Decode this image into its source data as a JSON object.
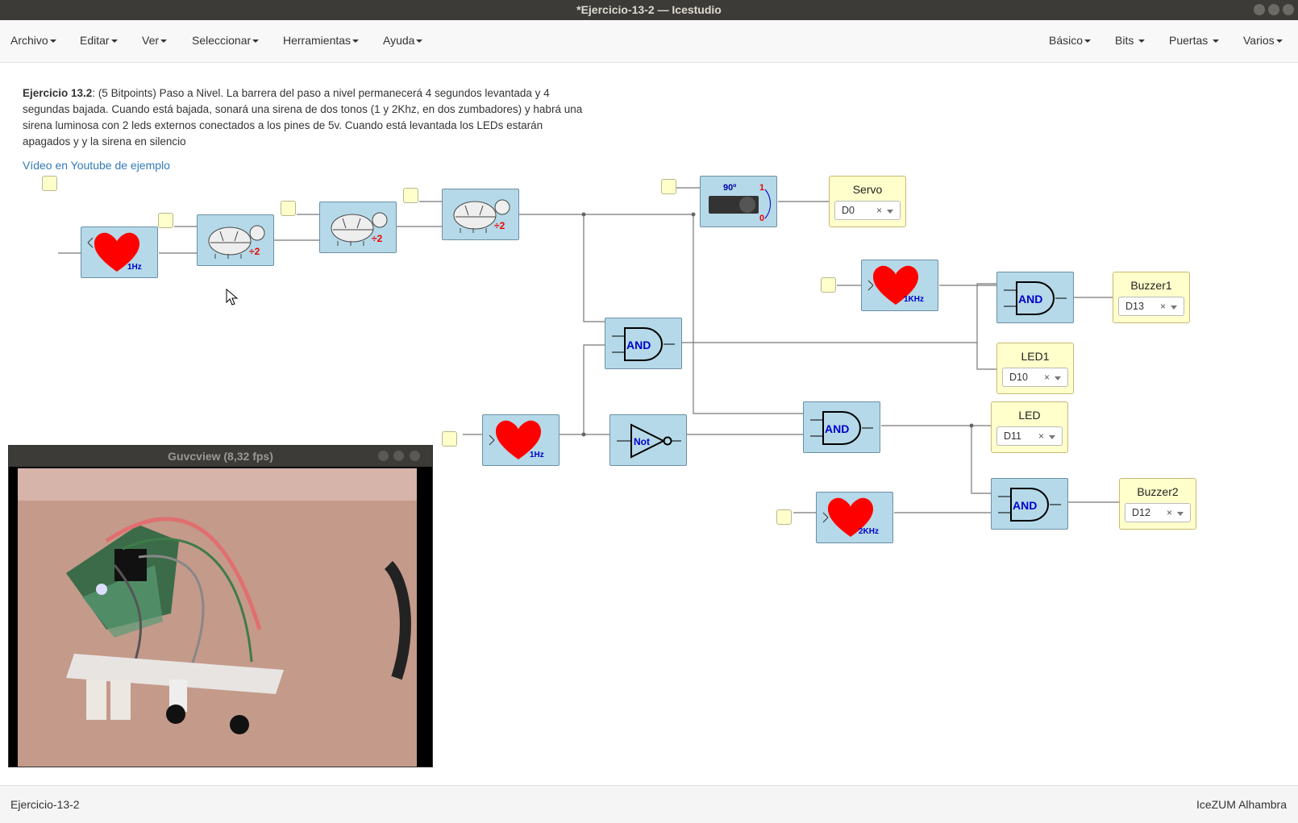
{
  "window": {
    "title": "*Ejercicio-13-2 — Icestudio"
  },
  "menu": {
    "left": [
      "Archivo",
      "Editar",
      "Ver",
      "Seleccionar",
      "Herramientas",
      "Ayuda"
    ],
    "right": [
      "Básico",
      "Bits",
      "Puertas",
      "Varios"
    ]
  },
  "description": {
    "title": "Ejercicio 13.2",
    "text": ": (5 Bitpoints) Paso a Nivel. La barrera del paso a nivel permanecerá 4 segundos levantada y 4 segundas bajada. Cuando está bajada, sonará una sirena de dos tonos (1 y 2Khz, en dos zumbadores) y habrá una sirena luminosa con 2 leds externos conectados a los pines de 5v. Cuando está levantada los LEDs estarán apagados y y la sirena en silencio",
    "link": "Vídeo en Youtube de ejemplo"
  },
  "blocks": {
    "heart1": "1Hz",
    "heart2": "1Hz",
    "heart3": "1KHz",
    "heart4": "2KHz",
    "div": "÷2",
    "and": "AND",
    "not": "Not",
    "servo_deg": "90º",
    "servo_one": "1",
    "servo_zero": "0"
  },
  "outputs": {
    "servo": {
      "name": "Servo",
      "pin": "D0"
    },
    "buzzer1": {
      "name": "Buzzer1",
      "pin": "D13"
    },
    "led1": {
      "name": "LED1",
      "pin": "D10"
    },
    "led": {
      "name": "LED",
      "pin": "D11"
    },
    "buzzer2": {
      "name": "Buzzer2",
      "pin": "D12"
    }
  },
  "guvcview": {
    "title": "Guvcview  (8,32 fps)"
  },
  "status": {
    "left": "Ejercicio-13-2",
    "right": "IceZUM Alhambra"
  }
}
